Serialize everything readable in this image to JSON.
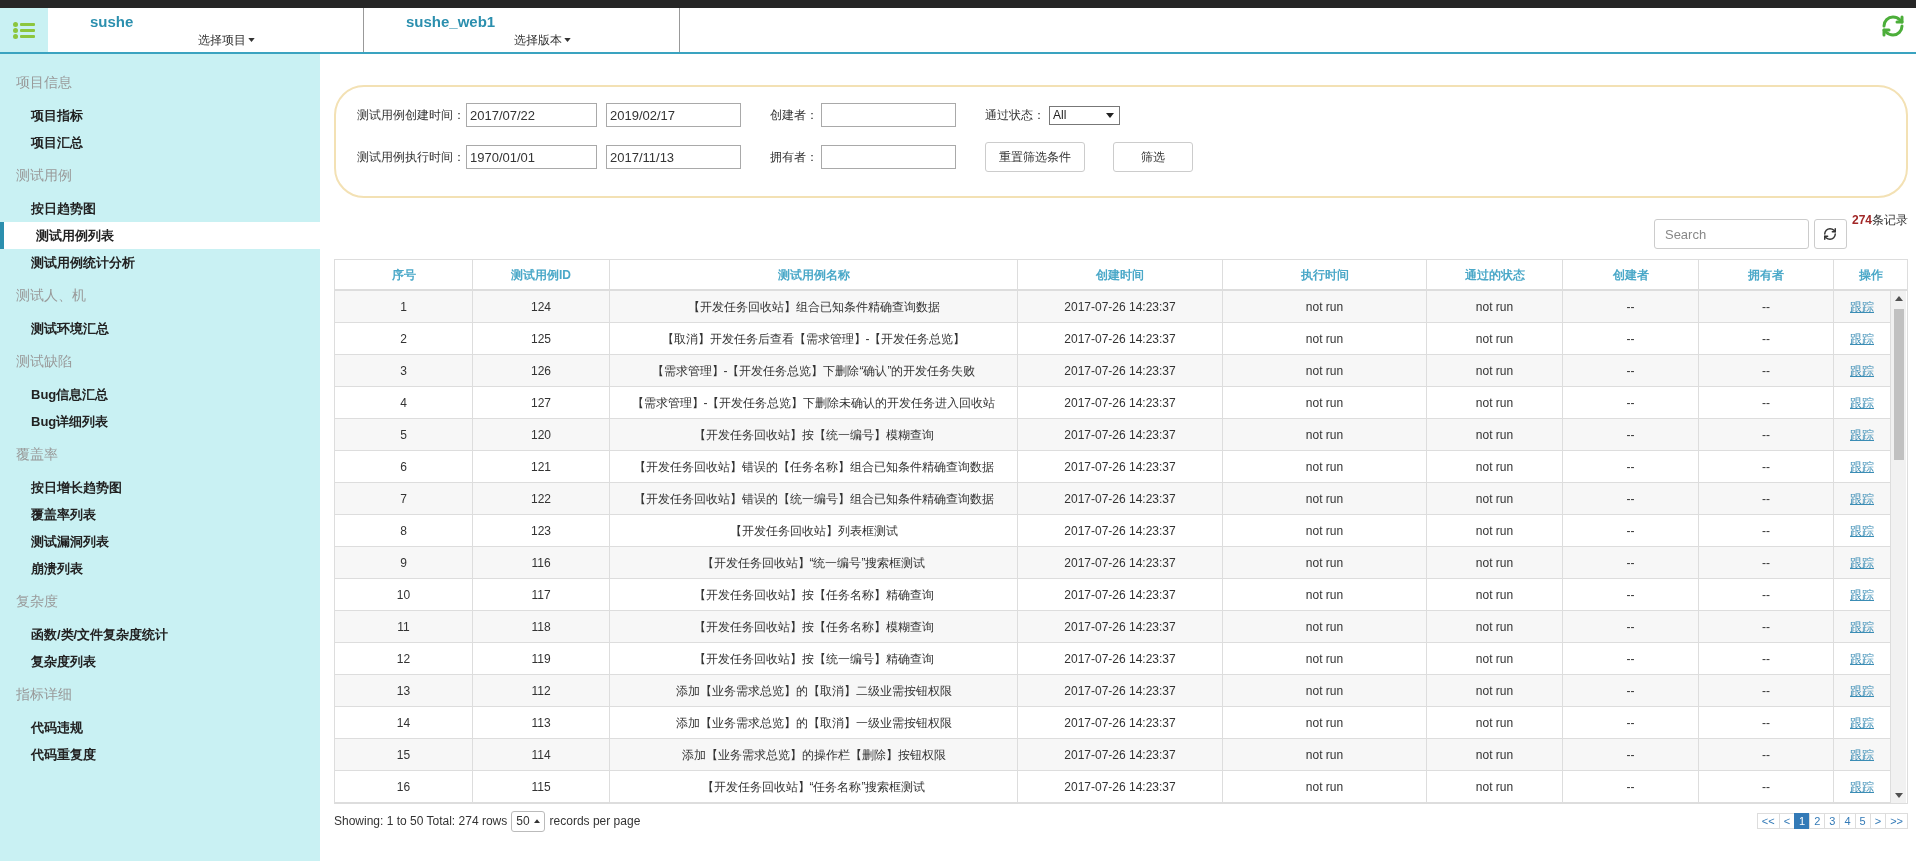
{
  "header": {
    "selectors": [
      {
        "name": "sushe",
        "picker": "选择项目"
      },
      {
        "name": "sushe_web1",
        "picker": "选择版本"
      }
    ]
  },
  "sidebar": {
    "sections": [
      {
        "title": "项目信息",
        "items": [
          {
            "label": "项目指标",
            "selected": false
          },
          {
            "label": "项目汇总",
            "selected": false
          }
        ]
      },
      {
        "title": "测试用例",
        "items": [
          {
            "label": "按日趋势图",
            "selected": false
          },
          {
            "label": "测试用例列表",
            "selected": true
          },
          {
            "label": "测试用例统计分析",
            "selected": false
          }
        ]
      },
      {
        "title": "测试人、机",
        "items": [
          {
            "label": "测试环境汇总",
            "selected": false
          }
        ]
      },
      {
        "title": "测试缺陷",
        "items": [
          {
            "label": "Bug信息汇总",
            "selected": false
          },
          {
            "label": "Bug详细列表",
            "selected": false
          }
        ]
      },
      {
        "title": "覆盖率",
        "items": [
          {
            "label": "按日增长趋势图",
            "selected": false
          },
          {
            "label": "覆盖率列表",
            "selected": false
          },
          {
            "label": "测试漏洞列表",
            "selected": false
          },
          {
            "label": "崩溃列表",
            "selected": false
          }
        ]
      },
      {
        "title": "复杂度",
        "items": [
          {
            "label": "函数/类/文件复杂度统计",
            "selected": false
          },
          {
            "label": "复杂度列表",
            "selected": false
          }
        ]
      },
      {
        "title": "指标详细",
        "items": [
          {
            "label": "代码违规",
            "selected": false
          },
          {
            "label": "代码重复度",
            "selected": false
          }
        ]
      }
    ]
  },
  "filters": {
    "rows": [
      {
        "label": "测试用例创建时间：",
        "from": "2017/07/22",
        "to": "2019/02/17",
        "person_label": "创建者："
      },
      {
        "label": "测试用例执行时间：",
        "from": "1970/01/01",
        "to": "2017/11/13",
        "person_label": "拥有者："
      }
    ],
    "status": {
      "label": "通过状态：",
      "value": "All"
    },
    "buttons": [
      "重置筛选条件",
      "筛选"
    ]
  },
  "records": {
    "count": "274",
    "label": "条记录"
  },
  "search": {
    "placeholder": "Search"
  },
  "table": {
    "columns": [
      {
        "label": "序号",
        "kind": "text"
      },
      {
        "label": "测试用例ID",
        "kind": "text"
      },
      {
        "label": "测试用例名称",
        "kind": "text"
      },
      {
        "label": "创建时间",
        "kind": "text"
      },
      {
        "label": "执行时间",
        "kind": "text"
      },
      {
        "label": "通过的状态",
        "kind": "text"
      },
      {
        "label": "创建者",
        "kind": "text"
      },
      {
        "label": "拥有者",
        "kind": "text"
      },
      {
        "label": "操作",
        "kind": "link"
      }
    ],
    "rows": [
      [
        "1",
        "124",
        "【开发任务回收站】组合已知条件精确查询数据",
        "2017-07-26 14:23:37",
        "not run",
        "not run",
        "--",
        "--",
        "跟踪"
      ],
      [
        "2",
        "125",
        "【取消】开发任务后查看【需求管理】-【开发任务总览】",
        "2017-07-26 14:23:37",
        "not run",
        "not run",
        "--",
        "--",
        "跟踪"
      ],
      [
        "3",
        "126",
        "【需求管理】-【开发任务总览】下删除“确认”的开发任务失败",
        "2017-07-26 14:23:37",
        "not run",
        "not run",
        "--",
        "--",
        "跟踪"
      ],
      [
        "4",
        "127",
        "【需求管理】-【开发任务总览】下删除未确认的开发任务进入回收站",
        "2017-07-26 14:23:37",
        "not run",
        "not run",
        "--",
        "--",
        "跟踪"
      ],
      [
        "5",
        "120",
        "【开发任务回收站】按【统一编号】模糊查询",
        "2017-07-26 14:23:37",
        "not run",
        "not run",
        "--",
        "--",
        "跟踪"
      ],
      [
        "6",
        "121",
        "【开发任务回收站】错误的【任务名称】组合已知条件精确查询数据",
        "2017-07-26 14:23:37",
        "not run",
        "not run",
        "--",
        "--",
        "跟踪"
      ],
      [
        "7",
        "122",
        "【开发任务回收站】错误的【统一编号】组合已知条件精确查询数据",
        "2017-07-26 14:23:37",
        "not run",
        "not run",
        "--",
        "--",
        "跟踪"
      ],
      [
        "8",
        "123",
        "【开发任务回收站】列表框测试",
        "2017-07-26 14:23:37",
        "not run",
        "not run",
        "--",
        "--",
        "跟踪"
      ],
      [
        "9",
        "116",
        "【开发任务回收站】“统一编号”搜索框测试",
        "2017-07-26 14:23:37",
        "not run",
        "not run",
        "--",
        "--",
        "跟踪"
      ],
      [
        "10",
        "117",
        "【开发任务回收站】按【任务名称】精确查询",
        "2017-07-26 14:23:37",
        "not run",
        "not run",
        "--",
        "--",
        "跟踪"
      ],
      [
        "11",
        "118",
        "【开发任务回收站】按【任务名称】模糊查询",
        "2017-07-26 14:23:37",
        "not run",
        "not run",
        "--",
        "--",
        "跟踪"
      ],
      [
        "12",
        "119",
        "【开发任务回收站】按【统一编号】精确查询",
        "2017-07-26 14:23:37",
        "not run",
        "not run",
        "--",
        "--",
        "跟踪"
      ],
      [
        "13",
        "112",
        "添加【业务需求总览】的【取消】二级业需按钮权限",
        "2017-07-26 14:23:37",
        "not run",
        "not run",
        "--",
        "--",
        "跟踪"
      ],
      [
        "14",
        "113",
        "添加【业务需求总览】的【取消】一级业需按钮权限",
        "2017-07-26 14:23:37",
        "not run",
        "not run",
        "--",
        "--",
        "跟踪"
      ],
      [
        "15",
        "114",
        "添加【业务需求总览】的操作栏【删除】按钮权限",
        "2017-07-26 14:23:37",
        "not run",
        "not run",
        "--",
        "--",
        "跟踪"
      ],
      [
        "16",
        "115",
        "【开发任务回收站】“任务名称”搜索框测试",
        "2017-07-26 14:23:37",
        "not run",
        "not run",
        "--",
        "--",
        "跟踪"
      ]
    ]
  },
  "footer": {
    "summary": "Showing: 1 to 50 Total: 274 rows",
    "page_size": "50",
    "page_size_label": "records per page",
    "pages": [
      {
        "label": "<<",
        "selected": false
      },
      {
        "label": "<",
        "selected": false
      },
      {
        "label": "1",
        "selected": true
      },
      {
        "label": "2",
        "selected": false
      },
      {
        "label": "3",
        "selected": false
      },
      {
        "label": "4",
        "selected": false
      },
      {
        "label": "5",
        "selected": false
      },
      {
        "label": ">",
        "selected": false
      },
      {
        "label": ">>",
        "selected": false
      }
    ]
  }
}
